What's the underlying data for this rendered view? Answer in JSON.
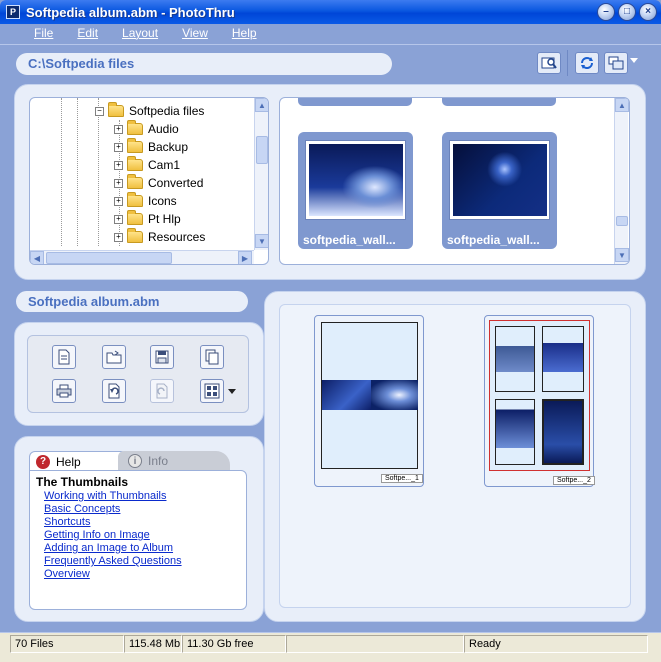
{
  "window": {
    "title": "Softpedia album.abm - PhotoThru",
    "app_icon_glyph": "P",
    "minimize": "–",
    "maximize": "□",
    "close": "×"
  },
  "menu": [
    "File",
    "Edit",
    "Layout",
    "View",
    "Help"
  ],
  "path_bar": {
    "label": "C:\\Softpedia files"
  },
  "toolbar_icons": [
    "browse-images-icon",
    "refresh-sync-icon",
    "view-mode-icon"
  ],
  "tree": {
    "root": "Softpedia files",
    "children": [
      "Audio",
      "Backup",
      "Cam1",
      "Converted",
      "Icons",
      "Pt Hlp",
      "Resources"
    ]
  },
  "thumbnails": [
    {
      "label": "softpedia_wall..."
    },
    {
      "label": "softpedia_wall..."
    }
  ],
  "album": {
    "title": "Softpedia album.abm",
    "pages": [
      {
        "label": "Softpe..._1"
      },
      {
        "label": "Softpe..._2"
      }
    ]
  },
  "album_tools": [
    "new-page-icon",
    "open-folder-icon",
    "save-icon",
    "copy-icon",
    "print-icon",
    "undo-icon",
    "rotate-icon",
    "layout-grid-icon"
  ],
  "help": {
    "tabs": [
      {
        "label": "Help",
        "icon": "?"
      },
      {
        "label": "Info",
        "icon": "i"
      }
    ],
    "title": "The Thumbnails",
    "links": [
      "Working with Thumbnails",
      "Basic Concepts",
      "Shortcuts",
      "Getting Info on Image",
      "Adding an Image to Album",
      "Frequently Asked Questions",
      "Overview"
    ]
  },
  "status": {
    "files": "70 Files",
    "size": "115.48 Mb",
    "free": "11.30 Gb free",
    "empty": "",
    "state": "Ready"
  }
}
